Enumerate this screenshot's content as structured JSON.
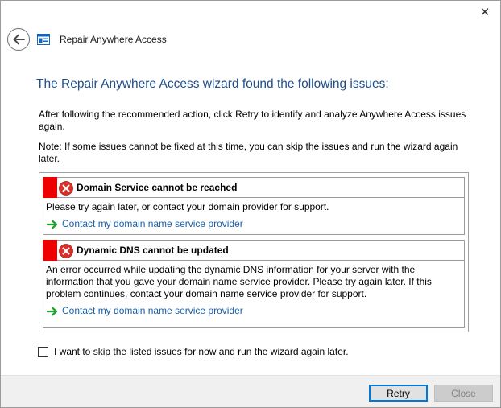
{
  "window": {
    "title": "Repair Anywhere Access",
    "close_glyph": "✕"
  },
  "heading": "The Repair Anywhere Access wizard found the following issues:",
  "instructions": {
    "paragraph1": "After following the recommended action, click Retry to identify and analyze Anywhere Access issues again.",
    "paragraph2": "Note: If some issues cannot be fixed at this time, you can skip the issues and run the wizard again later."
  },
  "issues": [
    {
      "title": "Domain Service cannot be reached",
      "description": "Please try again later, or contact your domain provider for support.",
      "link": "Contact my domain name service provider"
    },
    {
      "title": "Dynamic DNS cannot be updated",
      "description": "An error occurred while updating the dynamic DNS information for your server with the information that you gave your domain name service provider. Please try again later. If this problem continues, contact your domain name service provider for support.",
      "link": "Contact my domain name service provider"
    }
  ],
  "skip": {
    "label": "I want to skip the listed issues for now and run the wizard again later.",
    "checked": false
  },
  "buttons": {
    "retry_mnemonic": "R",
    "retry_rest": "etry",
    "close_mnemonic": "C",
    "close_rest": "lose"
  },
  "colors": {
    "accent": "#0078d7",
    "heading": "#1e4e8c",
    "link": "#1a5fa8",
    "error_bar": "#ee0000"
  },
  "icons": {
    "back": "back-arrow-icon",
    "app": "dashboard-app-icon",
    "error": "error-x-icon",
    "link_arrow": "green-arrow-icon",
    "close": "close-icon"
  }
}
